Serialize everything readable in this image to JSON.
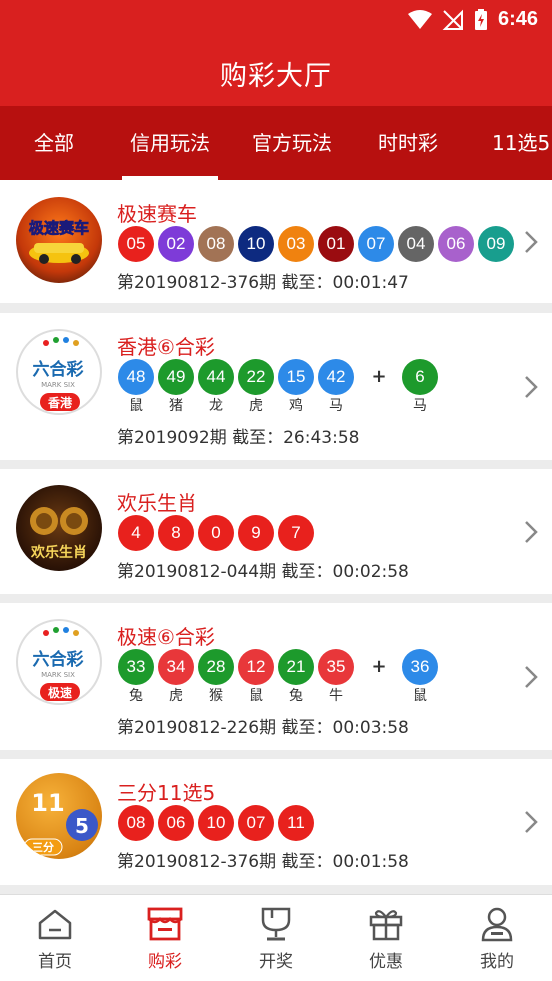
{
  "status": {
    "time": "6:46"
  },
  "header": {
    "title": "购彩大厅"
  },
  "tabs": [
    {
      "label": "全部"
    },
    {
      "label": "信用玩法"
    },
    {
      "label": "官方玩法"
    },
    {
      "label": "时时彩"
    },
    {
      "label": "11选5"
    }
  ],
  "games": [
    {
      "name": "极速赛车",
      "logo_text": "极速赛车",
      "balls": [
        {
          "n": "05",
          "color": "#e8211d"
        },
        {
          "n": "02",
          "color": "#7e3bd8"
        },
        {
          "n": "08",
          "color": "#a27355"
        },
        {
          "n": "10",
          "color": "#0d2a80"
        },
        {
          "n": "03",
          "color": "#f0820f"
        },
        {
          "n": "01",
          "color": "#9a0c10"
        },
        {
          "n": "07",
          "color": "#2d8ae8"
        },
        {
          "n": "04",
          "color": "#656565"
        },
        {
          "n": "06",
          "color": "#a861cc"
        },
        {
          "n": "09",
          "color": "#189e8e"
        }
      ],
      "period": "第20190812-376期   截至：00:01:47"
    },
    {
      "name": "香港⑥合彩",
      "logo_text": "六合彩",
      "logo_sub": "MARK SIX",
      "logo_tag": "香港",
      "balls": [
        {
          "n": "48",
          "color": "#2d8ae8",
          "z": "鼠"
        },
        {
          "n": "49",
          "color": "#1d9a2c",
          "z": "猪"
        },
        {
          "n": "44",
          "color": "#1d9a2c",
          "z": "龙"
        },
        {
          "n": "22",
          "color": "#1d9a2c",
          "z": "虎"
        },
        {
          "n": "15",
          "color": "#2d8ae8",
          "z": "鸡"
        },
        {
          "n": "42",
          "color": "#2d8ae8",
          "z": "马"
        }
      ],
      "plus": "+",
      "special": {
        "n": "6",
        "color": "#1d9a2c",
        "z": "马"
      },
      "period": "第2019092期   截至：26:43:58"
    },
    {
      "name": "欢乐生肖",
      "logo_text": "欢乐生肖",
      "balls": [
        {
          "n": "4",
          "color": "#e8211d"
        },
        {
          "n": "8",
          "color": "#e8211d"
        },
        {
          "n": "0",
          "color": "#e8211d"
        },
        {
          "n": "9",
          "color": "#e8211d"
        },
        {
          "n": "7",
          "color": "#e8211d"
        }
      ],
      "period": "第20190812-044期   截至：00:02:58"
    },
    {
      "name": "极速⑥合彩",
      "logo_text": "六合彩",
      "logo_sub": "MARK SIX",
      "logo_tag": "极速",
      "balls": [
        {
          "n": "33",
          "color": "#1d9a2c",
          "z": "兔"
        },
        {
          "n": "34",
          "color": "#e8373a",
          "z": "虎"
        },
        {
          "n": "28",
          "color": "#1d9a2c",
          "z": "猴"
        },
        {
          "n": "12",
          "color": "#e8373a",
          "z": "鼠"
        },
        {
          "n": "21",
          "color": "#1d9a2c",
          "z": "兔"
        },
        {
          "n": "35",
          "color": "#e8373a",
          "z": "牛"
        }
      ],
      "plus": "+",
      "special": {
        "n": "36",
        "color": "#2d8ae8",
        "z": "鼠"
      },
      "period": "第20190812-226期   截至：00:03:58"
    },
    {
      "name": "三分11选5",
      "logo_text": "11",
      "logo_badge": "5",
      "logo_tag": "三分",
      "balls": [
        {
          "n": "08",
          "color": "#e8211d"
        },
        {
          "n": "06",
          "color": "#e8211d"
        },
        {
          "n": "10",
          "color": "#e8211d"
        },
        {
          "n": "07",
          "color": "#e8211d"
        },
        {
          "n": "11",
          "color": "#e8211d"
        }
      ],
      "period": "第20190812-376期   截至：00:01:58"
    }
  ],
  "bottom_nav": [
    {
      "label": "首页",
      "icon": "home-icon"
    },
    {
      "label": "购彩",
      "icon": "store-icon"
    },
    {
      "label": "开奖",
      "icon": "trophy-icon"
    },
    {
      "label": "优惠",
      "icon": "gift-icon"
    },
    {
      "label": "我的",
      "icon": "user-icon"
    }
  ],
  "colors": {
    "brand": "#d9201f",
    "tab_bar": "#b7100f"
  }
}
